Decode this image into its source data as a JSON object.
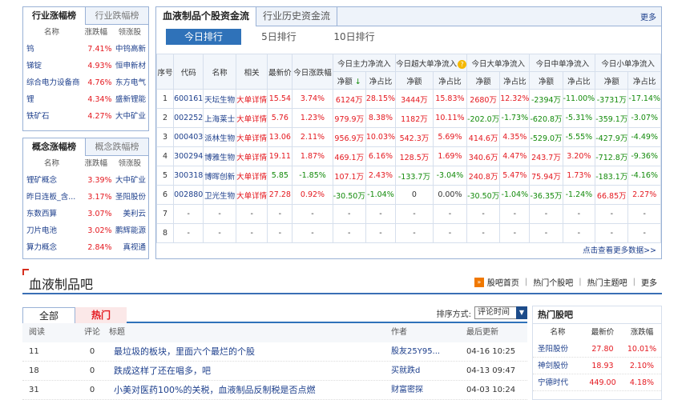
{
  "industry_box": {
    "tab_active": "行业涨幅榜",
    "tab_inactive": "行业跌幅榜",
    "headers": [
      "名称",
      "涨跌幅",
      "领涨股"
    ],
    "rows": [
      {
        "name": "钨",
        "pct": "7.41%",
        "leader": "中钨高新"
      },
      {
        "name": "锑锭",
        "pct": "4.93%",
        "leader": "恒申新材"
      },
      {
        "name": "综合电力设备商",
        "pct": "4.76%",
        "leader": "东方电气"
      },
      {
        "name": "锂",
        "pct": "4.34%",
        "leader": "盛新锂能"
      },
      {
        "name": "铁矿石",
        "pct": "4.27%",
        "leader": "大中矿业"
      }
    ]
  },
  "concept_box": {
    "tab_active": "概念涨幅榜",
    "tab_inactive": "概念跌幅榜",
    "headers": [
      "名称",
      "涨跌幅",
      "领涨股"
    ],
    "rows": [
      {
        "name": "锂矿概念",
        "pct": "3.39%",
        "leader": "大中矿业"
      },
      {
        "name": "昨日连板_含...",
        "pct": "3.17%",
        "leader": "圣阳股份"
      },
      {
        "name": "东数西算",
        "pct": "3.07%",
        "leader": "美利云"
      },
      {
        "name": "刀片电池",
        "pct": "3.02%",
        "leader": "鹏辉能源"
      },
      {
        "name": "算力概念",
        "pct": "2.84%",
        "leader": "真视通"
      }
    ]
  },
  "fund_flow": {
    "tab_active": "血液制品个股资金流",
    "tab_inactive": "行业历史资金流",
    "more": "更多",
    "subtabs": [
      "今日排行",
      "5日排行",
      "10日排行"
    ],
    "head1": [
      "序号",
      "代码",
      "名称",
      "相关",
      "最新价",
      "今日涨跌幅",
      "今日主力净流入",
      "今日超大单净流入",
      "今日大单净流入",
      "今日中单净流入",
      "今日小单净流入"
    ],
    "head2": [
      "净额",
      "净占比",
      "净额",
      "净占比",
      "净额",
      "净占比",
      "净额",
      "净占比",
      "净额",
      "净占比"
    ],
    "rows": [
      {
        "no": "1",
        "code": "600161",
        "name": "天坛生物",
        "rel": "大单详情",
        "price": "15.54",
        "chg": "3.74%",
        "m_amt": "6124万",
        "m_pct": "28.15%",
        "s_amt": "3444万",
        "s_pct": "15.83%",
        "l_amt": "2680万",
        "l_pct": "12.32%",
        "md_amt": "-2394万",
        "md_pct": "-11.00%",
        "sm_amt": "-3731万",
        "sm_pct": "-17.14%"
      },
      {
        "no": "2",
        "code": "002252",
        "name": "上海莱士",
        "rel": "大单详情",
        "price": "5.76",
        "chg": "1.23%",
        "m_amt": "979.9万",
        "m_pct": "8.38%",
        "s_amt": "1182万",
        "s_pct": "10.11%",
        "l_amt": "-202.0万",
        "l_pct": "-1.73%",
        "md_amt": "-620.8万",
        "md_pct": "-5.31%",
        "sm_amt": "-359.1万",
        "sm_pct": "-3.07%"
      },
      {
        "no": "3",
        "code": "000403",
        "name": "派林生物",
        "rel": "大单详情",
        "price": "13.06",
        "chg": "2.11%",
        "m_amt": "956.9万",
        "m_pct": "10.03%",
        "s_amt": "542.3万",
        "s_pct": "5.69%",
        "l_amt": "414.6万",
        "l_pct": "4.35%",
        "md_amt": "-529.0万",
        "md_pct": "-5.55%",
        "sm_amt": "-427.9万",
        "sm_pct": "-4.49%"
      },
      {
        "no": "4",
        "code": "300294",
        "name": "博雅生物",
        "rel": "大单详情",
        "price": "19.11",
        "chg": "1.87%",
        "m_amt": "469.1万",
        "m_pct": "6.16%",
        "s_amt": "128.5万",
        "s_pct": "1.69%",
        "l_amt": "340.6万",
        "l_pct": "4.47%",
        "md_amt": "243.7万",
        "md_pct": "3.20%",
        "sm_amt": "-712.8万",
        "sm_pct": "-9.36%"
      },
      {
        "no": "5",
        "code": "300318",
        "name": "博晖创新",
        "rel": "大单详情",
        "price": "5.85",
        "chg": "-1.85%",
        "m_amt": "107.1万",
        "m_pct": "2.43%",
        "s_amt": "-133.7万",
        "s_pct": "-3.04%",
        "l_amt": "240.8万",
        "l_pct": "5.47%",
        "md_amt": "75.94万",
        "md_pct": "1.73%",
        "sm_amt": "-183.1万",
        "sm_pct": "-4.16%"
      },
      {
        "no": "6",
        "code": "002880",
        "name": "卫光生物",
        "rel": "大单详情",
        "price": "27.28",
        "chg": "0.92%",
        "m_amt": "-30.50万",
        "m_pct": "-1.04%",
        "s_amt": "0",
        "s_pct": "0.00%",
        "l_amt": "-30.50万",
        "l_pct": "-1.04%",
        "md_amt": "-36.35万",
        "md_pct": "-1.24%",
        "sm_amt": "66.85万",
        "sm_pct": "2.27%"
      },
      {
        "no": "7",
        "code": "-",
        "name": "-",
        "rel": "-",
        "price": "-",
        "chg": "-",
        "m_amt": "-",
        "m_pct": "-",
        "s_amt": "-",
        "s_pct": "-",
        "l_amt": "-",
        "l_pct": "-",
        "md_amt": "-",
        "md_pct": "-",
        "sm_amt": "-",
        "sm_pct": "-"
      },
      {
        "no": "8",
        "code": "-",
        "name": "-",
        "rel": "-",
        "price": "-",
        "chg": "-",
        "m_amt": "-",
        "m_pct": "-",
        "s_amt": "-",
        "s_pct": "-",
        "l_amt": "-",
        "l_pct": "-",
        "md_amt": "-",
        "md_pct": "-",
        "sm_amt": "-",
        "sm_pct": "-"
      }
    ],
    "more_data": "点击查看更多数据>>"
  },
  "bar": {
    "title": "血液制品吧",
    "links": [
      "股吧首页",
      "热门个股吧",
      "热门主题吧",
      "更多"
    ]
  },
  "posts": {
    "tab_all": "全部",
    "tab_hot": "热门",
    "sort_label": "排序方式:",
    "sort_value": "评论时间",
    "headers": [
      "阅读",
      "评论",
      "标题",
      "作者",
      "最后更新"
    ],
    "rows": [
      {
        "reads": "11",
        "comments": "0",
        "title": "最垃圾的板块，里面六个最烂的个股",
        "author": "股友25Y95...",
        "updated": "04-16 10:25"
      },
      {
        "reads": "18",
        "comments": "0",
        "title": "跌成这样了还在唱多，吧",
        "author": "买就跌d",
        "updated": "04-13 09:47"
      },
      {
        "reads": "31",
        "comments": "0",
        "title": "小美对医药100%的关税，血液制品反制税是否点燃",
        "author": "财富密探",
        "updated": "04-03 10:24"
      }
    ]
  },
  "hot_stocks": {
    "title": "热门股吧",
    "headers": [
      "名称",
      "最新价",
      "涨跌幅"
    ],
    "rows": [
      {
        "name": "圣阳股份",
        "price": "27.80",
        "pct": "10.01%"
      },
      {
        "name": "神剑股份",
        "price": "18.93",
        "pct": "2.10%"
      },
      {
        "name": "宁德时代",
        "price": "449.00",
        "pct": "4.18%"
      }
    ]
  }
}
